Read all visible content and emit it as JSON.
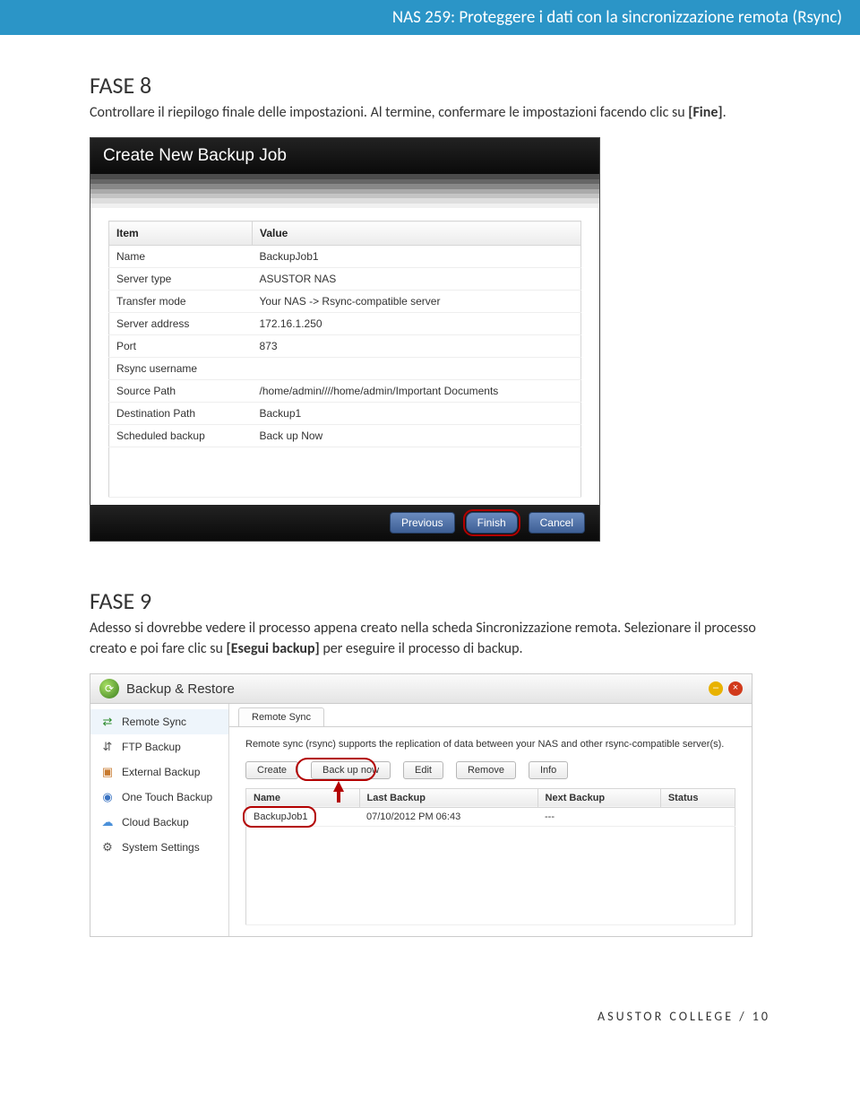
{
  "header": {
    "title": "NAS 259: Proteggere i dati con la sincronizzazione remota (Rsync)"
  },
  "phase8": {
    "title": "FASE 8",
    "text_a": "Controllare il riepilogo finale delle impostazioni. Al termine, confermare le impostazioni facendo clic su ",
    "text_b": "[Fine]",
    "text_c": "."
  },
  "dialog": {
    "title": "Create New Backup Job",
    "columns": {
      "item": "Item",
      "value": "Value"
    },
    "rows": [
      {
        "item": "Name",
        "value": "BackupJob1"
      },
      {
        "item": "Server type",
        "value": "ASUSTOR NAS"
      },
      {
        "item": "Transfer mode",
        "value": "Your NAS -> Rsync-compatible server"
      },
      {
        "item": "Server address",
        "value": "172.16.1.250"
      },
      {
        "item": "Port",
        "value": "873"
      },
      {
        "item": "Rsync username",
        "value": ""
      },
      {
        "item": "Source Path",
        "value": "/home/admin////home/admin/Important Documents"
      },
      {
        "item": "Destination Path",
        "value": "Backup1"
      },
      {
        "item": "Scheduled backup",
        "value": "Back up Now"
      }
    ],
    "buttons": {
      "previous": "Previous",
      "finish": "Finish",
      "cancel": "Cancel"
    }
  },
  "phase9": {
    "title": "FASE 9",
    "text_a": "Adesso si dovrebbe vedere il processo appena creato nella scheda Sincronizzazione remota. Selezionare il processo creato e poi fare clic su ",
    "text_b": "[Esegui backup]",
    "text_c": " per eseguire il processo di backup."
  },
  "app": {
    "title": "Backup & Restore",
    "sidebar": [
      {
        "label": "Remote Sync",
        "icon": "⇄",
        "cls": "ico-rs",
        "active": true
      },
      {
        "label": "FTP Backup",
        "icon": "⇵",
        "cls": "ico-ftp",
        "active": false
      },
      {
        "label": "External Backup",
        "icon": "▣",
        "cls": "ico-ext",
        "active": false
      },
      {
        "label": "One Touch Backup",
        "icon": "◉",
        "cls": "ico-ot",
        "active": false
      },
      {
        "label": "Cloud Backup",
        "icon": "☁",
        "cls": "ico-cb",
        "active": false
      },
      {
        "label": "System Settings",
        "icon": "⚙",
        "cls": "ico-ss",
        "active": false
      }
    ],
    "tab": "Remote Sync",
    "description": "Remote sync (rsync) supports the replication of data between your NAS and other rsync-compatible server(s).",
    "buttons": {
      "create": "Create",
      "backup": "Back up now",
      "edit": "Edit",
      "remove": "Remove",
      "info": "Info"
    },
    "job_columns": {
      "name": "Name",
      "last": "Last Backup",
      "next": "Next Backup",
      "status": "Status"
    },
    "job_row": {
      "name": "BackupJob1",
      "last": "07/10/2012 PM 06:43",
      "next": "---",
      "status": ""
    }
  },
  "footer": {
    "text": "ASUSTOR COLLEGE / 10"
  }
}
